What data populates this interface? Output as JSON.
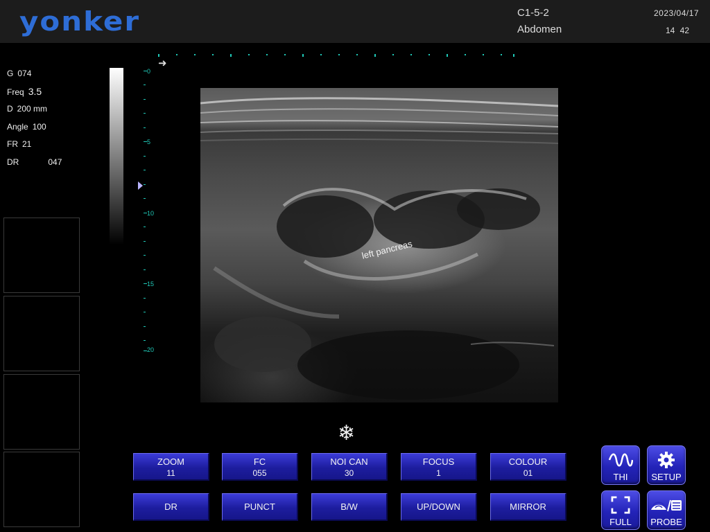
{
  "header": {
    "logo": "yonker",
    "probe_code": "C1-5-2",
    "exam": "Abdomen",
    "date": "2023/04/17",
    "time": "14 42",
    "logo_color": "#2e6dd6"
  },
  "params": [
    {
      "label": "G",
      "value": "074"
    },
    {
      "label": "Freq",
      "value": "3.5"
    },
    {
      "label": "D",
      "value": "200 mm"
    },
    {
      "label": "Angle",
      "value": "100"
    },
    {
      "label": "FR",
      "value": "21"
    },
    {
      "label": "DR",
      "value": "047"
    }
  ],
  "depth_scale": {
    "labels": [
      "0",
      "5",
      "10",
      "15",
      "20"
    ],
    "color": "#1fc9b8"
  },
  "image": {
    "annotation": "left pancreas",
    "orientation_icon": "arrow-right-icon"
  },
  "freeze_icon": "snowflake-icon",
  "controls": {
    "row1": [
      {
        "label": "ZOOM",
        "value": "11"
      },
      {
        "label": "FC",
        "value": "055"
      },
      {
        "label": "NOI CAN",
        "value": "30"
      },
      {
        "label": "FOCUS",
        "value": "1"
      },
      {
        "label": "COLOUR",
        "value": "01"
      }
    ],
    "row2": [
      {
        "label": "DR"
      },
      {
        "label": "PUNCT"
      },
      {
        "label": "B/W"
      },
      {
        "label": "UP/DOWN"
      },
      {
        "label": "MIRROR"
      }
    ]
  },
  "tools": [
    {
      "label": "THI",
      "icon": "waveform-icon"
    },
    {
      "label": "SETUP",
      "icon": "gear-icon"
    },
    {
      "label": "FULL",
      "icon": "fullscreen-icon"
    },
    {
      "label": "PROBE",
      "icon": "probe-icon"
    }
  ],
  "button_color": "#2323b8"
}
